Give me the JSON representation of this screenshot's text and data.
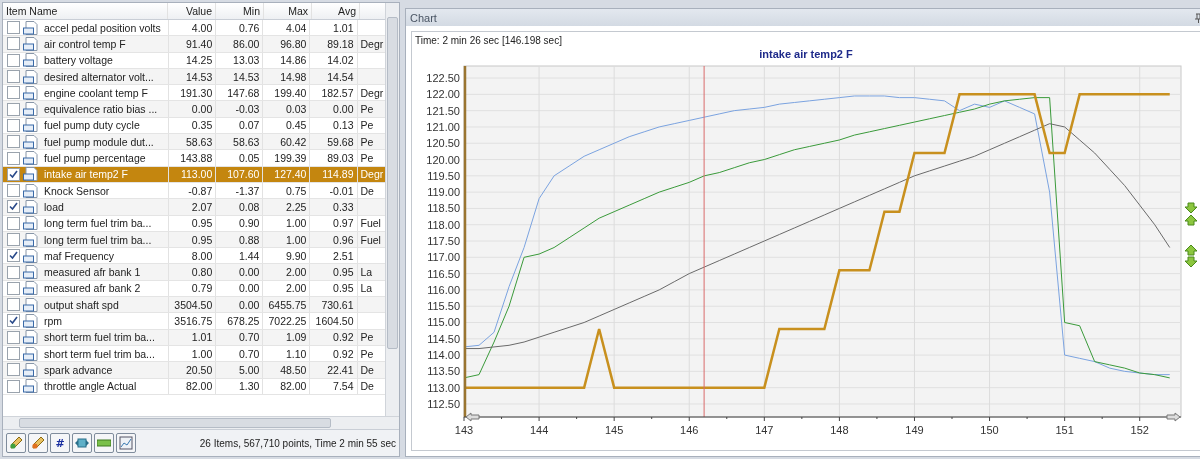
{
  "table": {
    "columns": [
      "Item Name",
      "Value",
      "Min",
      "Max",
      "Avg"
    ],
    "rows": [
      {
        "name": "accel pedal position volts",
        "value": "4.00",
        "min": "0.76",
        "max": "4.04",
        "avg": "1.01",
        "checked": false,
        "selected": false
      },
      {
        "name": "air control temp F",
        "value": "91.40",
        "min": "86.00",
        "max": "96.80",
        "avg": "89.18",
        "unit": "Degr",
        "checked": false,
        "selected": false
      },
      {
        "name": "battery voltage",
        "value": "14.25",
        "min": "13.03",
        "max": "14.86",
        "avg": "14.02",
        "checked": false,
        "selected": false
      },
      {
        "name": "desired alternator volt...",
        "value": "14.53",
        "min": "14.53",
        "max": "14.98",
        "avg": "14.54",
        "checked": false,
        "selected": false
      },
      {
        "name": "engine coolant temp F",
        "value": "191.30",
        "min": "147.68",
        "max": "199.40",
        "avg": "182.57",
        "unit": "Degr",
        "checked": false,
        "selected": false
      },
      {
        "name": "equivalence ratio bias ...",
        "value": "0.00",
        "min": "-0.03",
        "max": "0.03",
        "avg": "0.00",
        "unit": "Pe",
        "checked": false,
        "selected": false
      },
      {
        "name": "fuel pump duty cycle",
        "value": "0.35",
        "min": "0.07",
        "max": "0.45",
        "avg": "0.13",
        "unit": "Pe",
        "checked": false,
        "selected": false
      },
      {
        "name": "fuel pump module dut...",
        "value": "58.63",
        "min": "58.63",
        "max": "60.42",
        "avg": "59.68",
        "unit": "Pe",
        "checked": false,
        "selected": false
      },
      {
        "name": "fuel pump percentage",
        "value": "143.88",
        "min": "0.05",
        "max": "199.39",
        "avg": "89.03",
        "unit": "Pe",
        "checked": false,
        "selected": false
      },
      {
        "name": "intake air temp2 F",
        "value": "113.00",
        "min": "107.60",
        "max": "127.40",
        "avg": "114.89",
        "unit": "Degr",
        "checked": true,
        "selected": true
      },
      {
        "name": "Knock Sensor",
        "value": "-0.87",
        "min": "-1.37",
        "max": "0.75",
        "avg": "-0.01",
        "unit": "De",
        "checked": false,
        "selected": false
      },
      {
        "name": "load",
        "value": "2.07",
        "min": "0.08",
        "max": "2.25",
        "avg": "0.33",
        "checked": true,
        "selected": false
      },
      {
        "name": "long term fuel trim ba...",
        "value": "0.95",
        "min": "0.90",
        "max": "1.00",
        "avg": "0.97",
        "unit": "Fuel",
        "checked": false,
        "selected": false
      },
      {
        "name": "long term fuel trim ba...",
        "value": "0.95",
        "min": "0.88",
        "max": "1.00",
        "avg": "0.96",
        "unit": "Fuel",
        "checked": false,
        "selected": false
      },
      {
        "name": "maf Frequency",
        "value": "8.00",
        "min": "1.44",
        "max": "9.90",
        "avg": "2.51",
        "checked": true,
        "selected": false
      },
      {
        "name": "measured afr bank 1",
        "value": "0.80",
        "min": "0.00",
        "max": "2.00",
        "avg": "0.95",
        "unit": "La",
        "checked": false,
        "selected": false
      },
      {
        "name": "measured afr bank 2",
        "value": "0.79",
        "min": "0.00",
        "max": "2.00",
        "avg": "0.95",
        "unit": "La",
        "checked": false,
        "selected": false
      },
      {
        "name": "output shaft spd",
        "value": "3504.50",
        "min": "0.00",
        "max": "6455.75",
        "avg": "730.61",
        "checked": false,
        "selected": false
      },
      {
        "name": "rpm",
        "value": "3516.75",
        "min": "678.25",
        "max": "7022.25",
        "avg": "1604.50",
        "checked": true,
        "selected": false
      },
      {
        "name": "short term fuel trim ba...",
        "value": "1.01",
        "min": "0.70",
        "max": "1.09",
        "avg": "0.92",
        "unit": "Pe",
        "checked": false,
        "selected": false
      },
      {
        "name": "short term fuel trim ba...",
        "value": "1.00",
        "min": "0.70",
        "max": "1.10",
        "avg": "0.92",
        "unit": "Pe",
        "checked": false,
        "selected": false
      },
      {
        "name": "spark advance",
        "value": "20.50",
        "min": "5.00",
        "max": "48.50",
        "avg": "22.41",
        "unit": "De",
        "checked": false,
        "selected": false
      },
      {
        "name": "throttle angle Actual",
        "value": "82.00",
        "min": "1.30",
        "max": "82.00",
        "avg": "7.54",
        "unit": "De",
        "checked": false,
        "selected": false
      }
    ]
  },
  "toolbar": [
    {
      "kind": "edit"
    },
    {
      "kind": "edit-alt"
    },
    {
      "kind": "number",
      "label": "#"
    },
    {
      "kind": "fit"
    },
    {
      "kind": "line"
    },
    {
      "kind": "chart"
    }
  ],
  "status": "26 Items, 567,710 points, Time 2 min 55 sec",
  "chart_panel": {
    "title": "Chart",
    "time": "Time: 2 min 26 sec [146.198 sec]",
    "chart_data": {
      "type": "line",
      "title": "intake air temp2 F",
      "x": [
        143.0,
        143.2,
        143.4,
        143.6,
        143.8,
        144.0,
        144.2,
        144.4,
        144.6,
        144.8,
        145.0,
        145.2,
        145.4,
        145.6,
        145.8,
        146.0,
        146.2,
        146.4,
        146.6,
        146.8,
        147.0,
        147.2,
        147.4,
        147.6,
        147.8,
        148.0,
        148.2,
        148.4,
        148.6,
        148.8,
        149.0,
        149.2,
        149.4,
        149.6,
        149.8,
        150.0,
        150.2,
        150.4,
        150.6,
        150.8,
        151.0,
        151.2,
        151.4,
        151.6,
        151.8,
        152.0,
        152.2,
        152.4
      ],
      "series": [
        {
          "color": "#7ba3e0",
          "values": [
            114.25,
            114.3,
            114.7,
            116.1,
            117.3,
            118.8,
            119.5,
            119.8,
            120.1,
            120.3,
            120.5,
            120.7,
            120.85,
            121.0,
            121.1,
            121.2,
            121.3,
            121.4,
            121.5,
            121.55,
            121.6,
            121.7,
            121.75,
            121.8,
            121.85,
            121.9,
            121.95,
            121.95,
            121.95,
            121.9,
            121.9,
            121.85,
            121.8,
            121.5,
            121.7,
            121.6,
            121.8,
            121.6,
            121.4,
            119.0,
            114.0,
            113.9,
            113.8,
            113.6,
            113.5,
            113.45,
            113.4,
            113.4
          ]
        },
        {
          "color": "#3a9a3a",
          "values": [
            113.3,
            113.4,
            114.4,
            115.5,
            117.0,
            117.1,
            117.3,
            117.6,
            117.9,
            118.2,
            118.4,
            118.6,
            118.8,
            119.0,
            119.15,
            119.3,
            119.5,
            119.6,
            119.75,
            119.9,
            120.0,
            120.15,
            120.3,
            120.4,
            120.5,
            120.6,
            120.75,
            120.85,
            120.95,
            121.05,
            121.15,
            121.25,
            121.35,
            121.45,
            121.55,
            121.7,
            121.8,
            121.85,
            121.9,
            121.9,
            115.0,
            114.9,
            113.8,
            113.7,
            113.6,
            113.45,
            113.4,
            113.3
          ]
        },
        {
          "color": "#6a6a6a",
          "values": [
            114.2,
            114.2,
            114.25,
            114.3,
            114.4,
            114.55,
            114.7,
            114.85,
            115.0,
            115.2,
            115.4,
            115.6,
            115.8,
            116.0,
            116.25,
            116.5,
            116.7,
            116.9,
            117.1,
            117.3,
            117.5,
            117.7,
            117.9,
            118.1,
            118.3,
            118.5,
            118.7,
            118.9,
            119.1,
            119.3,
            119.5,
            119.65,
            119.8,
            119.95,
            120.1,
            120.3,
            120.5,
            120.7,
            120.9,
            121.1,
            121.0,
            120.6,
            120.2,
            119.7,
            119.2,
            118.6,
            118.0,
            117.3
          ]
        },
        {
          "color": "#c8901e",
          "values": [
            113,
            113,
            113,
            113,
            113,
            113,
            113,
            113,
            113,
            114.8,
            113,
            113,
            113,
            113,
            113,
            113,
            113,
            113,
            113,
            113,
            113,
            114.8,
            114.8,
            114.8,
            114.8,
            116.6,
            116.6,
            116.6,
            118.4,
            118.4,
            120.2,
            120.2,
            120.2,
            122.0,
            122.0,
            122.0,
            122.0,
            122.0,
            122.0,
            120.2,
            120.2,
            122.0,
            122.0,
            122.0,
            122.0,
            122.0,
            122.0,
            122.0
          ]
        }
      ],
      "xlim": [
        143,
        152.55
      ],
      "ylim": [
        112.1,
        122.87
      ],
      "xticks": [
        143,
        144,
        145,
        146,
        147,
        148,
        149,
        150,
        151,
        152
      ],
      "yticks": [
        {
          "value": 112.5,
          "label": "112.50"
        },
        {
          "value": 113,
          "label": "113.00"
        },
        {
          "value": 113.5,
          "label": "113.50"
        },
        {
          "value": 114,
          "label": "114.00"
        },
        {
          "value": 114.5,
          "label": "114.50"
        },
        {
          "value": 115,
          "label": "115.00"
        },
        {
          "value": 115.5,
          "label": "115.50"
        },
        {
          "value": 116,
          "label": "116.00"
        },
        {
          "value": 116.5,
          "label": "116.50"
        },
        {
          "value": 117,
          "label": "117.00"
        },
        {
          "value": 117.5,
          "label": "117.50"
        },
        {
          "value": 118,
          "label": "118.00"
        },
        {
          "value": 118.5,
          "label": "118.50"
        },
        {
          "value": 119,
          "label": "119.00"
        },
        {
          "value": 119.5,
          "label": "119.50"
        },
        {
          "value": 120,
          "label": "120.00"
        },
        {
          "value": 120.5,
          "label": "120.50"
        },
        {
          "value": 121,
          "label": "121.00"
        },
        {
          "value": 121.5,
          "label": "121.50"
        },
        {
          "value": 122,
          "label": "122.00"
        },
        {
          "value": 122.5,
          "label": "122.50"
        }
      ],
      "grid": true,
      "ref_lines": [
        {
          "axis": "x",
          "value": 146.198,
          "color": "#d96a6a"
        }
      ]
    }
  }
}
